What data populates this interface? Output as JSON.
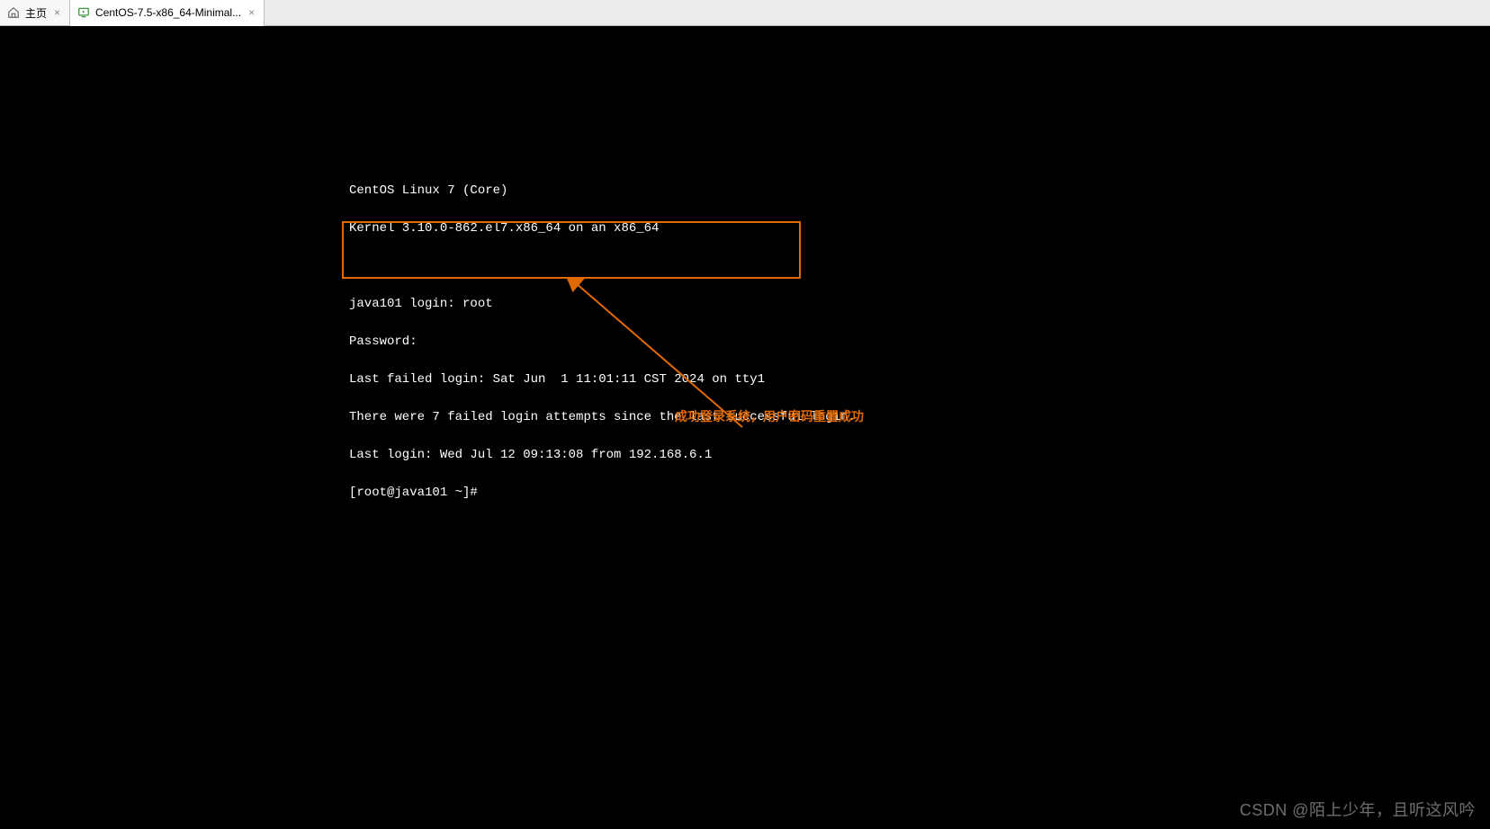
{
  "tabs": [
    {
      "label": "主页",
      "icon": "home-icon"
    },
    {
      "label": "CentOS-7.5-x86_64-Minimal...",
      "icon": "vm-icon"
    }
  ],
  "terminal": {
    "line0": "CentOS Linux 7 (Core)",
    "line1": "Kernel 3.10.0-862.el7.x86_64 on an x86_64",
    "blank0": "",
    "line2": "java101 login: root",
    "line3": "Password:",
    "line4": "Last failed login: Sat Jun  1 11:01:11 CST 2024 on tty1",
    "line5": "There were 7 failed login attempts since the last successful login.",
    "line6": "Last login: Wed Jul 12 09:13:08 from 192.168.6.1",
    "line7": "[root@java101 ~]#"
  },
  "annotation_text": "成功登录系统，用户密码重置成功",
  "highlight_color": "#e06a00",
  "watermark": "CSDN @陌上少年，且听这风吟"
}
